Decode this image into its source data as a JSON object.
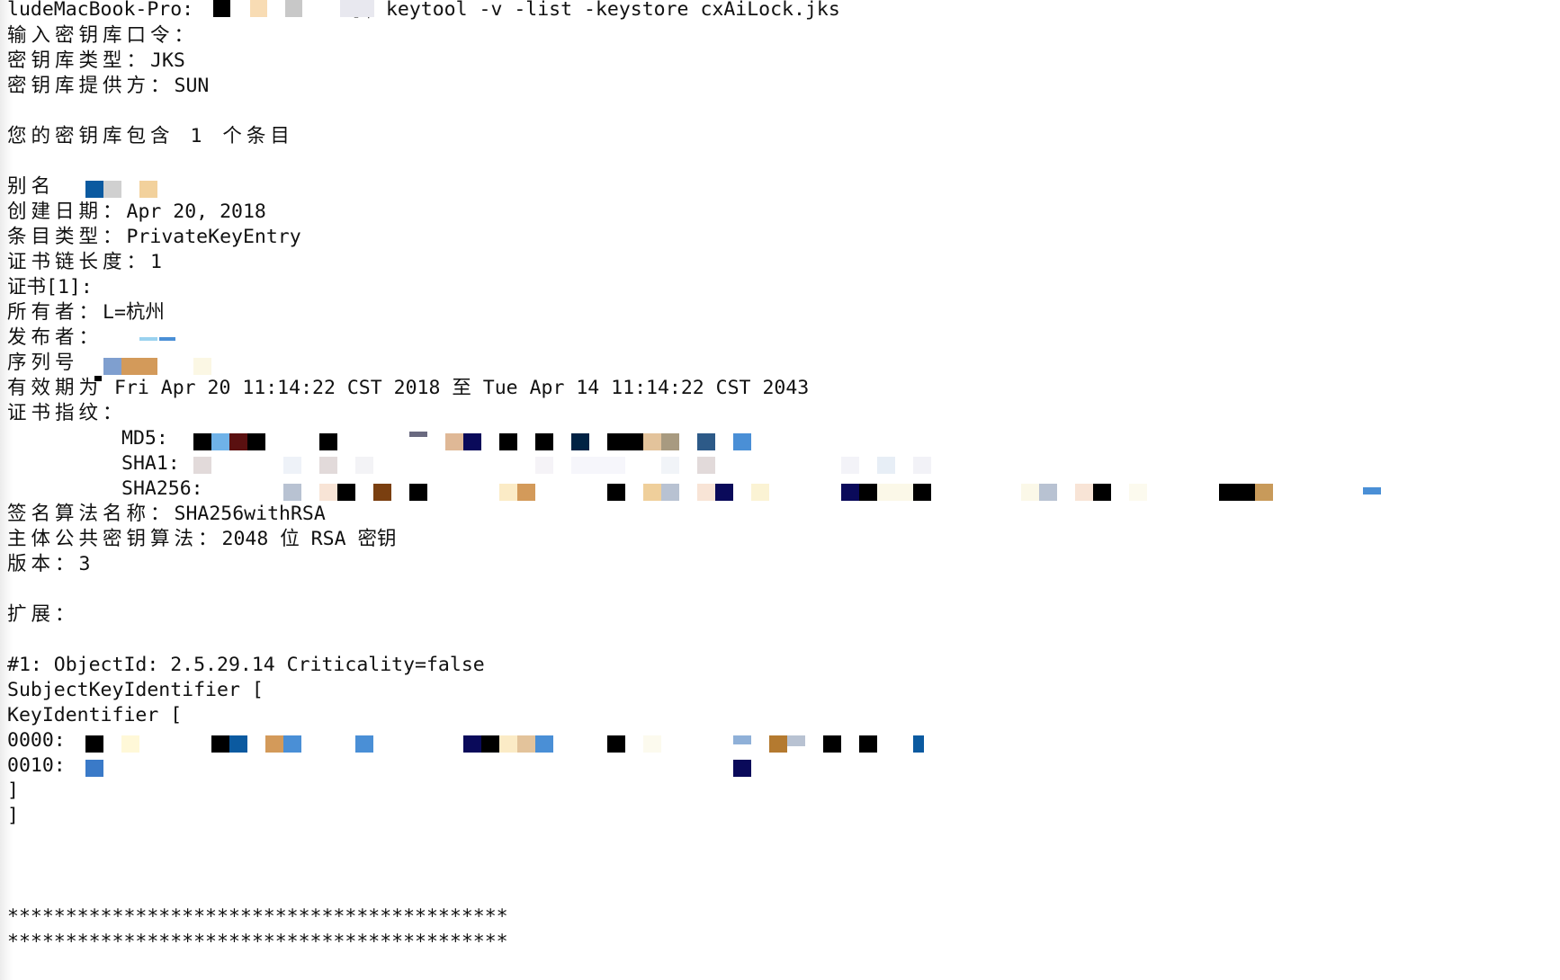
{
  "prompt": {
    "host": "ludeMacBook-Pro:",
    "suffix": "]$",
    "command": "keytool -v -list -keystore cxAiLock.jks"
  },
  "keystore": {
    "password_prompt": "输入密钥库口令：",
    "type_label": "密钥库类型：",
    "type_value": "JKS",
    "provider_label": "密钥库提供方：",
    "provider_value": "SUN",
    "summary": "您的密钥库包含 1 个条目"
  },
  "entry": {
    "alias_label": "别名",
    "creation_label": "创建日期：",
    "creation_value": "Apr 20, 2018",
    "entry_type_label": "条目类型：",
    "entry_type_value": "PrivateKeyEntry",
    "chain_length_label": "证书链长度：",
    "chain_length_value": "1",
    "cert_label": "证书[1]:",
    "owner_label": "所有者：",
    "owner_value": "L=杭州",
    "issuer_label": "发布者：",
    "serial_label": "序列号",
    "validity_label": "有效期为",
    "validity_value": "Fri Apr 20 11:14:22 CST 2018 至 Tue Apr 14 11:14:22 CST 2043",
    "fingerprints_label": "证书指纹：",
    "md5_label": "MD5:",
    "sha1_label": "SHA1:",
    "sha256_label": "SHA256:",
    "sig_alg_label": "签名算法名称：",
    "sig_alg_value": "SHA256withRSA",
    "pubkey_alg_label": "主体公共密钥算法：",
    "pubkey_alg_value": "2048 位 RSA 密钥",
    "version_label": "版本：",
    "version_value": "3"
  },
  "extensions": {
    "label": "扩展：",
    "ext1_header": "#1: ObjectId: 2.5.29.14 Criticality=false",
    "ski_line": "SubjectKeyIdentifier [",
    "ki_line": "KeyIdentifier [",
    "row0_label": "0000:",
    "row1_label": "0010:",
    "close1": "]",
    "close2": "]"
  },
  "footer": {
    "stars1": "*******************************************",
    "stars2": "*******************************************"
  },
  "redaction_colors": [
    "#000000",
    "#0b5aa0",
    "#4a8fd6",
    "#5a1010",
    "#d39a5a",
    "#e3c39b",
    "#0a0a5a",
    "#002244",
    "#7a3f10",
    "#a89a80",
    "#c8c8c8",
    "#f7f0d0",
    "#e7e0e0",
    "#b8c2d2"
  ]
}
